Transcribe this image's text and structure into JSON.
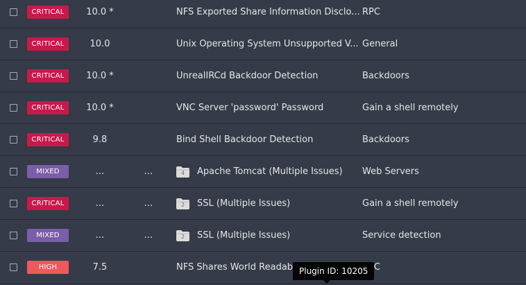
{
  "colors": {
    "critical": "#c8194b",
    "mixed": "#7b5ea7",
    "high": "#f0595b",
    "background": "#353b48"
  },
  "rows": [
    {
      "severity": "CRITICAL",
      "severity_type": "critical",
      "score": "10.0 *",
      "vpr": "",
      "name": "NFS Exported Share Information Disclo...",
      "family": "RPC",
      "folder_count": ""
    },
    {
      "severity": "CRITICAL",
      "severity_type": "critical",
      "score": "10.0",
      "vpr": "",
      "name": "Unix Operating System Unsupported V...",
      "family": "General",
      "folder_count": ""
    },
    {
      "severity": "CRITICAL",
      "severity_type": "critical",
      "score": "10.0 *",
      "vpr": "",
      "name": "UnrealIRCd Backdoor Detection",
      "family": "Backdoors",
      "folder_count": ""
    },
    {
      "severity": "CRITICAL",
      "severity_type": "critical",
      "score": "10.0 *",
      "vpr": "",
      "name": "VNC Server 'password' Password",
      "family": "Gain a shell remotely",
      "folder_count": ""
    },
    {
      "severity": "CRITICAL",
      "severity_type": "critical",
      "score": "9.8",
      "vpr": "",
      "name": "Bind Shell Backdoor Detection",
      "family": "Backdoors",
      "folder_count": ""
    },
    {
      "severity": "MIXED",
      "severity_type": "mixed",
      "score": "...",
      "vpr": "...",
      "name": "Apache Tomcat (Multiple Issues)",
      "family": "Web Servers",
      "folder_count": "4"
    },
    {
      "severity": "CRITICAL",
      "severity_type": "critical",
      "score": "...",
      "vpr": "...",
      "name": "SSL (Multiple Issues)",
      "family": "Gain a shell remotely",
      "folder_count": "2"
    },
    {
      "severity": "MIXED",
      "severity_type": "mixed",
      "score": "...",
      "vpr": "...",
      "name": "SSL (Multiple Issues)",
      "family": "Service detection",
      "folder_count": "2"
    },
    {
      "severity": "HIGH",
      "severity_type": "high",
      "score": "7.5",
      "vpr": "",
      "name": "NFS Shares World Readable",
      "family": "RPC",
      "folder_count": ""
    }
  ],
  "tooltip": {
    "text": "Plugin ID: 10205"
  }
}
